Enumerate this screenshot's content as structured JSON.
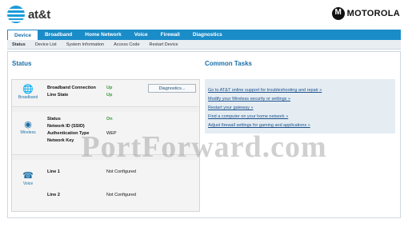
{
  "header": {
    "brand": "at&t",
    "partner": "MOTOROLA"
  },
  "nav": {
    "tabs": [
      "Device",
      "Broadband",
      "Home Network",
      "Voice",
      "Firewall",
      "Diagnostics"
    ],
    "active_tab": "Device",
    "subtabs": [
      "Status",
      "Device List",
      "System Information",
      "Access Code",
      "Restart Device"
    ],
    "active_subtab": "Status"
  },
  "status": {
    "title": "Status",
    "broadband": {
      "icon": "globe-icon",
      "caption": "Broadband",
      "connection_label": "Broadband Connection",
      "connection_value": "Up",
      "line_label": "Line State",
      "line_value": "Up",
      "diagnostics_button": "Diagnostics..."
    },
    "wireless": {
      "icon": "wifi-icon",
      "caption": "Wireless",
      "status_label": "Status",
      "status_value": "On",
      "ssid_label": "Network ID (SSID)",
      "ssid_value": "",
      "auth_label": "Authentication Type",
      "auth_value": "WEP",
      "key_label": "Network Key",
      "key_value": ""
    },
    "voice": {
      "icon": "phone-icon",
      "caption": "Voice",
      "line1_label": "Line 1",
      "line1_value": "Not Configured",
      "line2_label": "Line 2",
      "line2_value": "Not Configured"
    }
  },
  "tasks": {
    "title": "Common Tasks",
    "items": [
      "Go to AT&T online support for troubleshooting and repair »",
      "Modify your Wireless security or settings »",
      "Restart your gateway »",
      "Find a computer on your home network »",
      "Adjust firewall settings for gaming and applications »"
    ]
  },
  "watermark": "PortForward.com",
  "colors": {
    "accent": "#1a8cc8",
    "status_up": "#3a9a3a"
  }
}
